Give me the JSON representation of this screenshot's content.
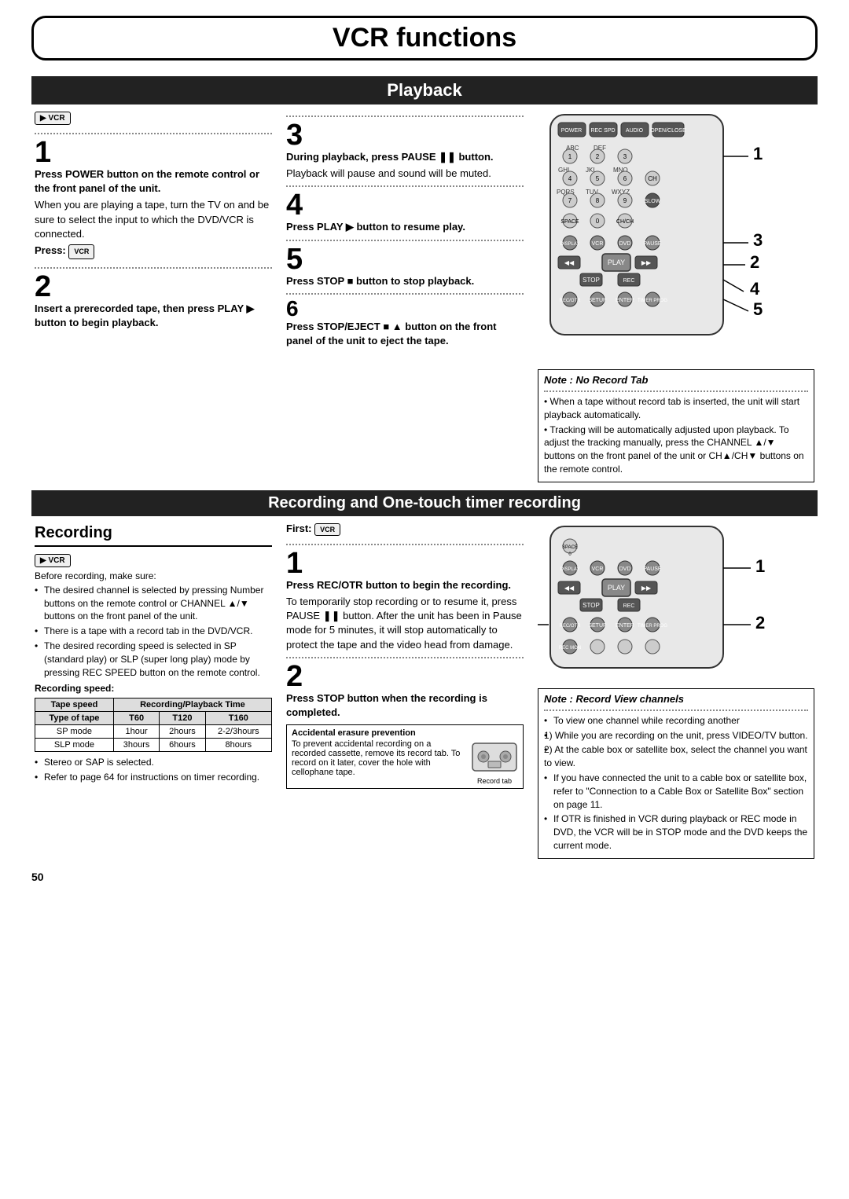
{
  "page": {
    "title": "VCR functions",
    "page_number": "50"
  },
  "playback": {
    "section_title": "Playback",
    "col1": {
      "step1_num": "1",
      "step1_heading": "Press POWER button on the remote control or the front panel of the unit.",
      "step1_body": "When you are playing a tape, turn the TV on and be sure to select the input to which the DVD/VCR is connected.",
      "step1_press": "Press:",
      "step2_num": "2",
      "step2_heading": "Insert a prerecorded tape, then press PLAY ▶ button to begin playback."
    },
    "col2": {
      "step3_num": "3",
      "step3_heading": "During playback, press PAUSE ❚❚ button.",
      "step3_body": "Playback will pause and sound will be muted.",
      "step4_num": "4",
      "step4_heading": "Press PLAY ▶ button to resume play.",
      "step5_num": "5",
      "step5_heading": "Press STOP ■ button to stop playback.",
      "step6_num": "6",
      "step6_heading": "Press STOP/EJECT ■ ▲ button on the front panel of the unit to eject the tape."
    },
    "col3": {
      "note_title": "Note : No Record Tab",
      "note1": "When a tape without record tab is inserted, the unit will start playback automatically.",
      "note2": "Tracking will be automatically adjusted upon playback. To adjust the tracking manually, press the CHANNEL ▲/▼ buttons on the front panel of the unit or CH▲/CH▼ buttons on the remote control."
    }
  },
  "recording": {
    "section_title": "Recording and One-touch timer recording",
    "subsection_title": "Recording",
    "col1": {
      "before_recording": "Before recording, make sure:",
      "bullets": [
        "The desired channel is selected by pressing Number buttons on the remote control or CHANNEL ▲/▼ buttons on the front panel of the unit.",
        "There is a tape with a record tab in the DVD/VCR.",
        "The desired recording speed is selected in SP (standard play) or SLP (super long play) mode by pressing REC SPEED button on the remote control."
      ],
      "rec_speed_label": "Recording speed:",
      "table": {
        "headers": [
          "Tape speed",
          "Recording/Playback Time",
          "",
          ""
        ],
        "subheaders": [
          "Type of tape",
          "T60",
          "T120",
          "T160"
        ],
        "rows": [
          [
            "SP mode",
            "1hour",
            "2hours",
            "2-2/3hours"
          ],
          [
            "SLP mode",
            "3hours",
            "6hours",
            "8hours"
          ]
        ]
      },
      "bullets2": [
        "Stereo or SAP is selected.",
        "Refer to page 64 for instructions on timer recording."
      ]
    },
    "col2": {
      "first_label": "First:",
      "step1_num": "1",
      "step1_heading": "Press REC/OTR button to begin the recording.",
      "step1_body": "To temporarily stop recording or to resume it, press PAUSE ❚❚ button. After the unit has been in Pause mode for 5 minutes, it will stop automatically to protect the tape and the video head from damage.",
      "step2_num": "2",
      "step2_heading": "Press STOP button when the recording is completed.",
      "accidental_title": "Accidental erasure prevention",
      "accidental_body": "To prevent accidental recording on a recorded cassette, remove its record tab. To record on it later, cover the hole with cellophane tape.",
      "record_tab_label": "Record tab"
    },
    "col3": {
      "note_title": "Note : Record View channels",
      "note_bullets": [
        "To view one channel while recording another",
        "1) While you are recording on the unit, press VIDEO/TV button.",
        "2) At the cable box or satellite box, select the channel you want to view.",
        "If you have connected the unit to a cable box or satellite box, refer to \"Connection to a Cable Box or Satellite Box\" section on page 11.",
        "If OTR is finished in VCR during playback or REC mode in DVD, the VCR will be in STOP mode and the DVD keeps the current mode."
      ]
    }
  }
}
